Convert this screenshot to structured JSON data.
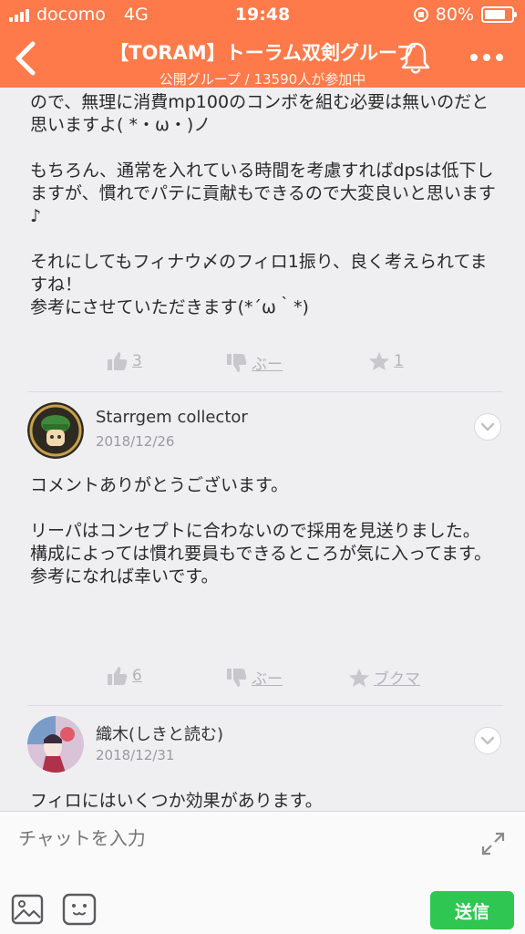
{
  "status_bar": {
    "carrier": "docomo",
    "network": "4G",
    "time": "19:48",
    "battery": "80%",
    "battery_level": 0.8
  },
  "header": {
    "title": "【TORAM】トーラム双剣グループ",
    "subtitle": "公開グループ / 13590人が参加中",
    "back_icon": "chevron-left-icon",
    "bell_icon": "bell-icon",
    "more_icon": "more-icon",
    "more_glyph": "•••",
    "back_glyph": "<",
    "colors": {
      "header_bg": "#ff7a4a",
      "send_bg": "#2fc651"
    }
  },
  "post1": {
    "text": "ので、無理に消費mp100のコンボを組む必要は無いのだと思いますよ( *・ω・)ノ\n\nもちろん、通常を入れている時間を考慮すればdpsは低下しますが、慣れでパテに貢献もできるので大変良いと思います♪\n\nそれにしてもフィナウ〆のフィロ1振り、良く考えられてますね！\n参考にさせていただきます(*´ω｀*)",
    "like_count": "3",
    "boo_label": "ぶー",
    "star_count": "1"
  },
  "comment1": {
    "author": "Starrgem collector",
    "date": "2018/12/26",
    "text": "コメントありがとうございます。\n\nリーパはコンセプトに合わないので採用を見送りました。\n構成によっては慣れ要員もできるところが気に入ってます。\n参考になれば幸いです。",
    "like_count": "6",
    "boo_label": "ぶー",
    "bookmark_label": "ブクマ"
  },
  "comment2": {
    "author": "織木(しきと読む)",
    "date": "2018/12/31",
    "text": "フィロにはいくつか効果があります。"
  },
  "input_bar": {
    "placeholder": "チャットを入力",
    "send_label": "送信"
  }
}
